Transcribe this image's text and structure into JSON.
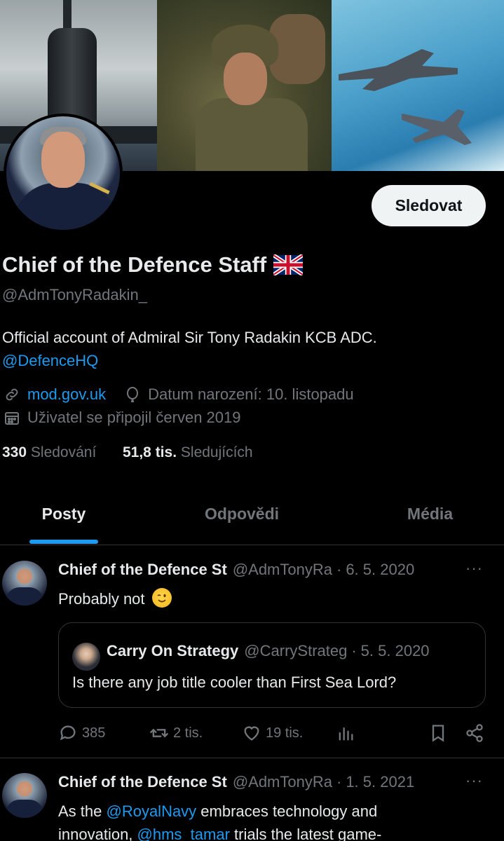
{
  "profile": {
    "display_name": "Chief of the Defence Staff",
    "handle": "@AdmTonyRadakin_",
    "follow_label": "Sledovat",
    "bio_text": "Official account of Admiral Sir Tony Radakin KCB ADC.",
    "bio_mention": "@DefenceHQ",
    "website": "mod.gov.uk",
    "birthday": "Datum narození: 10. listopadu",
    "joined": "Uživatel se připojil červen 2019",
    "following_count": "330",
    "following_label": "Sledování",
    "followers_count": "51,8 tis.",
    "followers_label": "Sledujících"
  },
  "tabs": [
    {
      "label": "Posty"
    },
    {
      "label": "Odpovědi"
    },
    {
      "label": "Média"
    }
  ],
  "tweets": [
    {
      "name": "Chief of the Defence St",
      "handle": "@AdmTonyRa",
      "date": "6. 5. 2020",
      "text": "Probably not",
      "quote": {
        "name": "Carry On Strategy",
        "handle": "@CarryStrateg",
        "date": "5. 5. 2020",
        "text": "Is there any job title cooler than First Sea Lord?"
      },
      "replies": "385",
      "reposts": "2 tis.",
      "likes": "19 tis."
    },
    {
      "name": "Chief of the Defence St",
      "handle": "@AdmTonyRa",
      "date": "1. 5. 2021",
      "text_prefix": "As the ",
      "text_mention": "@RoyalNavy",
      "text_suffix": " embraces technology and",
      "text_line2_a": "innovation, ",
      "text_line2_mention": "@hms_tamar",
      "text_line2_b": " trials the latest game-"
    }
  ],
  "ui": {
    "dot": "·",
    "more": "···"
  },
  "colors": {
    "background": "#000000",
    "accent": "#1d9bf0",
    "text_primary": "#e7e9ea",
    "text_secondary": "#71767b"
  }
}
